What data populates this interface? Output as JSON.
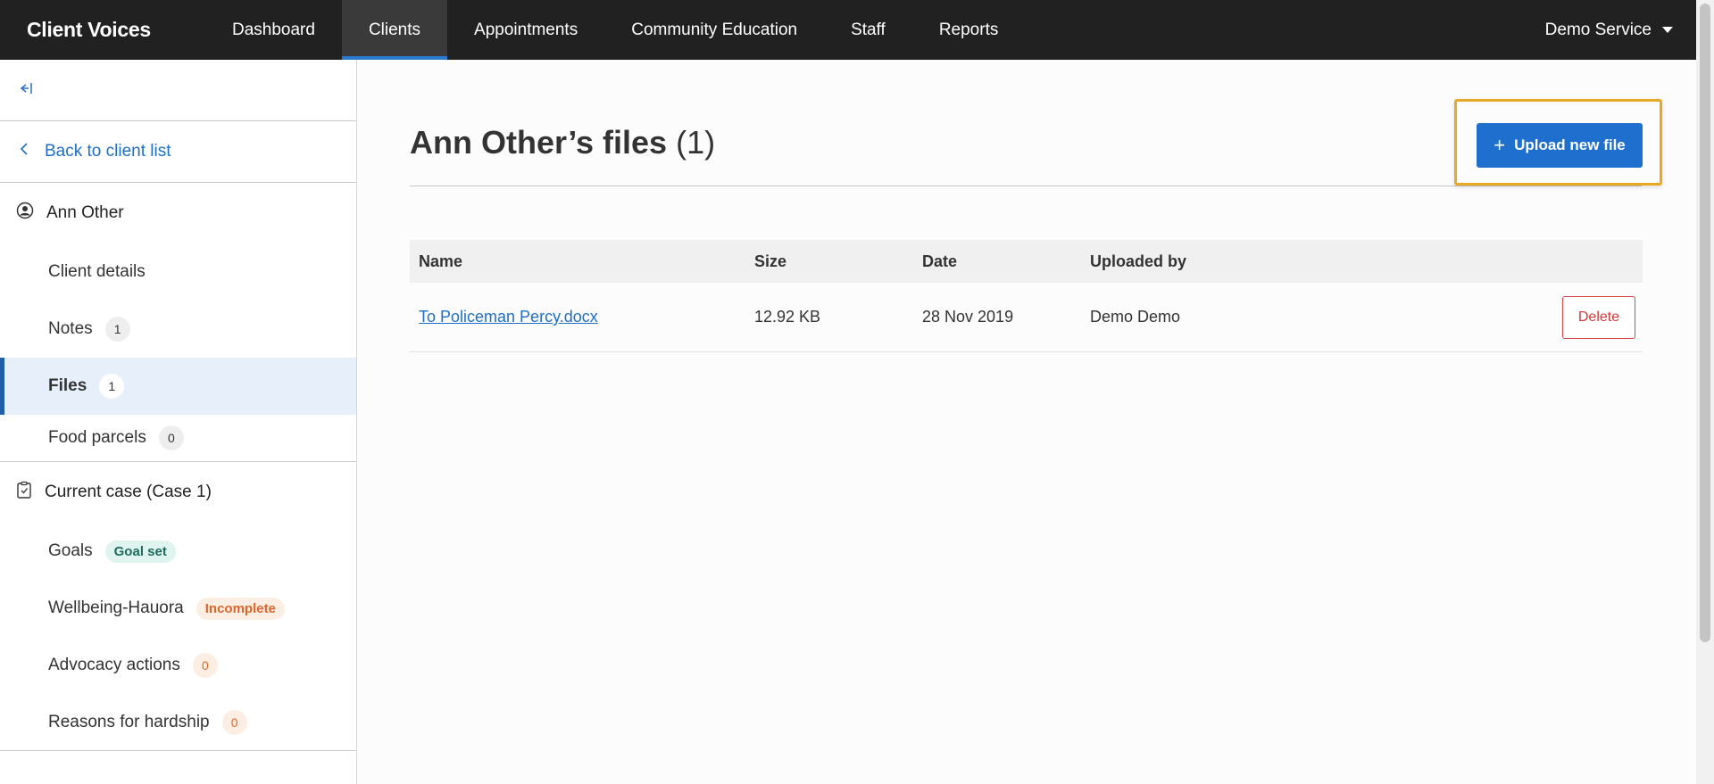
{
  "header": {
    "brand": "Client Voices",
    "nav": [
      {
        "label": "Dashboard"
      },
      {
        "label": "Clients"
      },
      {
        "label": "Appointments"
      },
      {
        "label": "Community Education"
      },
      {
        "label": "Staff"
      },
      {
        "label": "Reports"
      }
    ],
    "active_nav": "Clients",
    "service": "Demo Service"
  },
  "sidebar": {
    "collapse_icon": "collapse-left-icon",
    "back_label": "Back to client list",
    "client_name": "Ann Other",
    "client_items": [
      {
        "label": "Client details",
        "badge": null
      },
      {
        "label": "Notes",
        "badge": "1"
      },
      {
        "label": "Files",
        "badge": "1"
      },
      {
        "label": "Food parcels",
        "badge": "0"
      }
    ],
    "active_item": "Files",
    "case_title": "Current case (Case 1)",
    "case_items": {
      "goals": {
        "label": "Goals",
        "status": "Goal set"
      },
      "wellbeing": {
        "label": "Wellbeing-Hauora",
        "status": "Incomplete"
      },
      "advocacy": {
        "label": "Advocacy actions",
        "badge": "0"
      },
      "hardship": {
        "label": "Reasons for hardship",
        "badge": "0"
      }
    }
  },
  "main": {
    "title": "Ann Other’s files",
    "title_count": "(1)",
    "upload_label": "Upload new file",
    "table": {
      "headers": [
        "Name",
        "Size",
        "Date",
        "Uploaded by"
      ],
      "rows": [
        {
          "name": "To Policeman Percy.docx",
          "size": "12.92 KB",
          "date": "28 Nov 2019",
          "uploaded_by": "Demo Demo",
          "action": "Delete"
        }
      ]
    }
  },
  "colors": {
    "topbar": "#212121",
    "accent": "#1e6fce",
    "highlight": "#e9a825",
    "danger": "#d23b3b"
  }
}
